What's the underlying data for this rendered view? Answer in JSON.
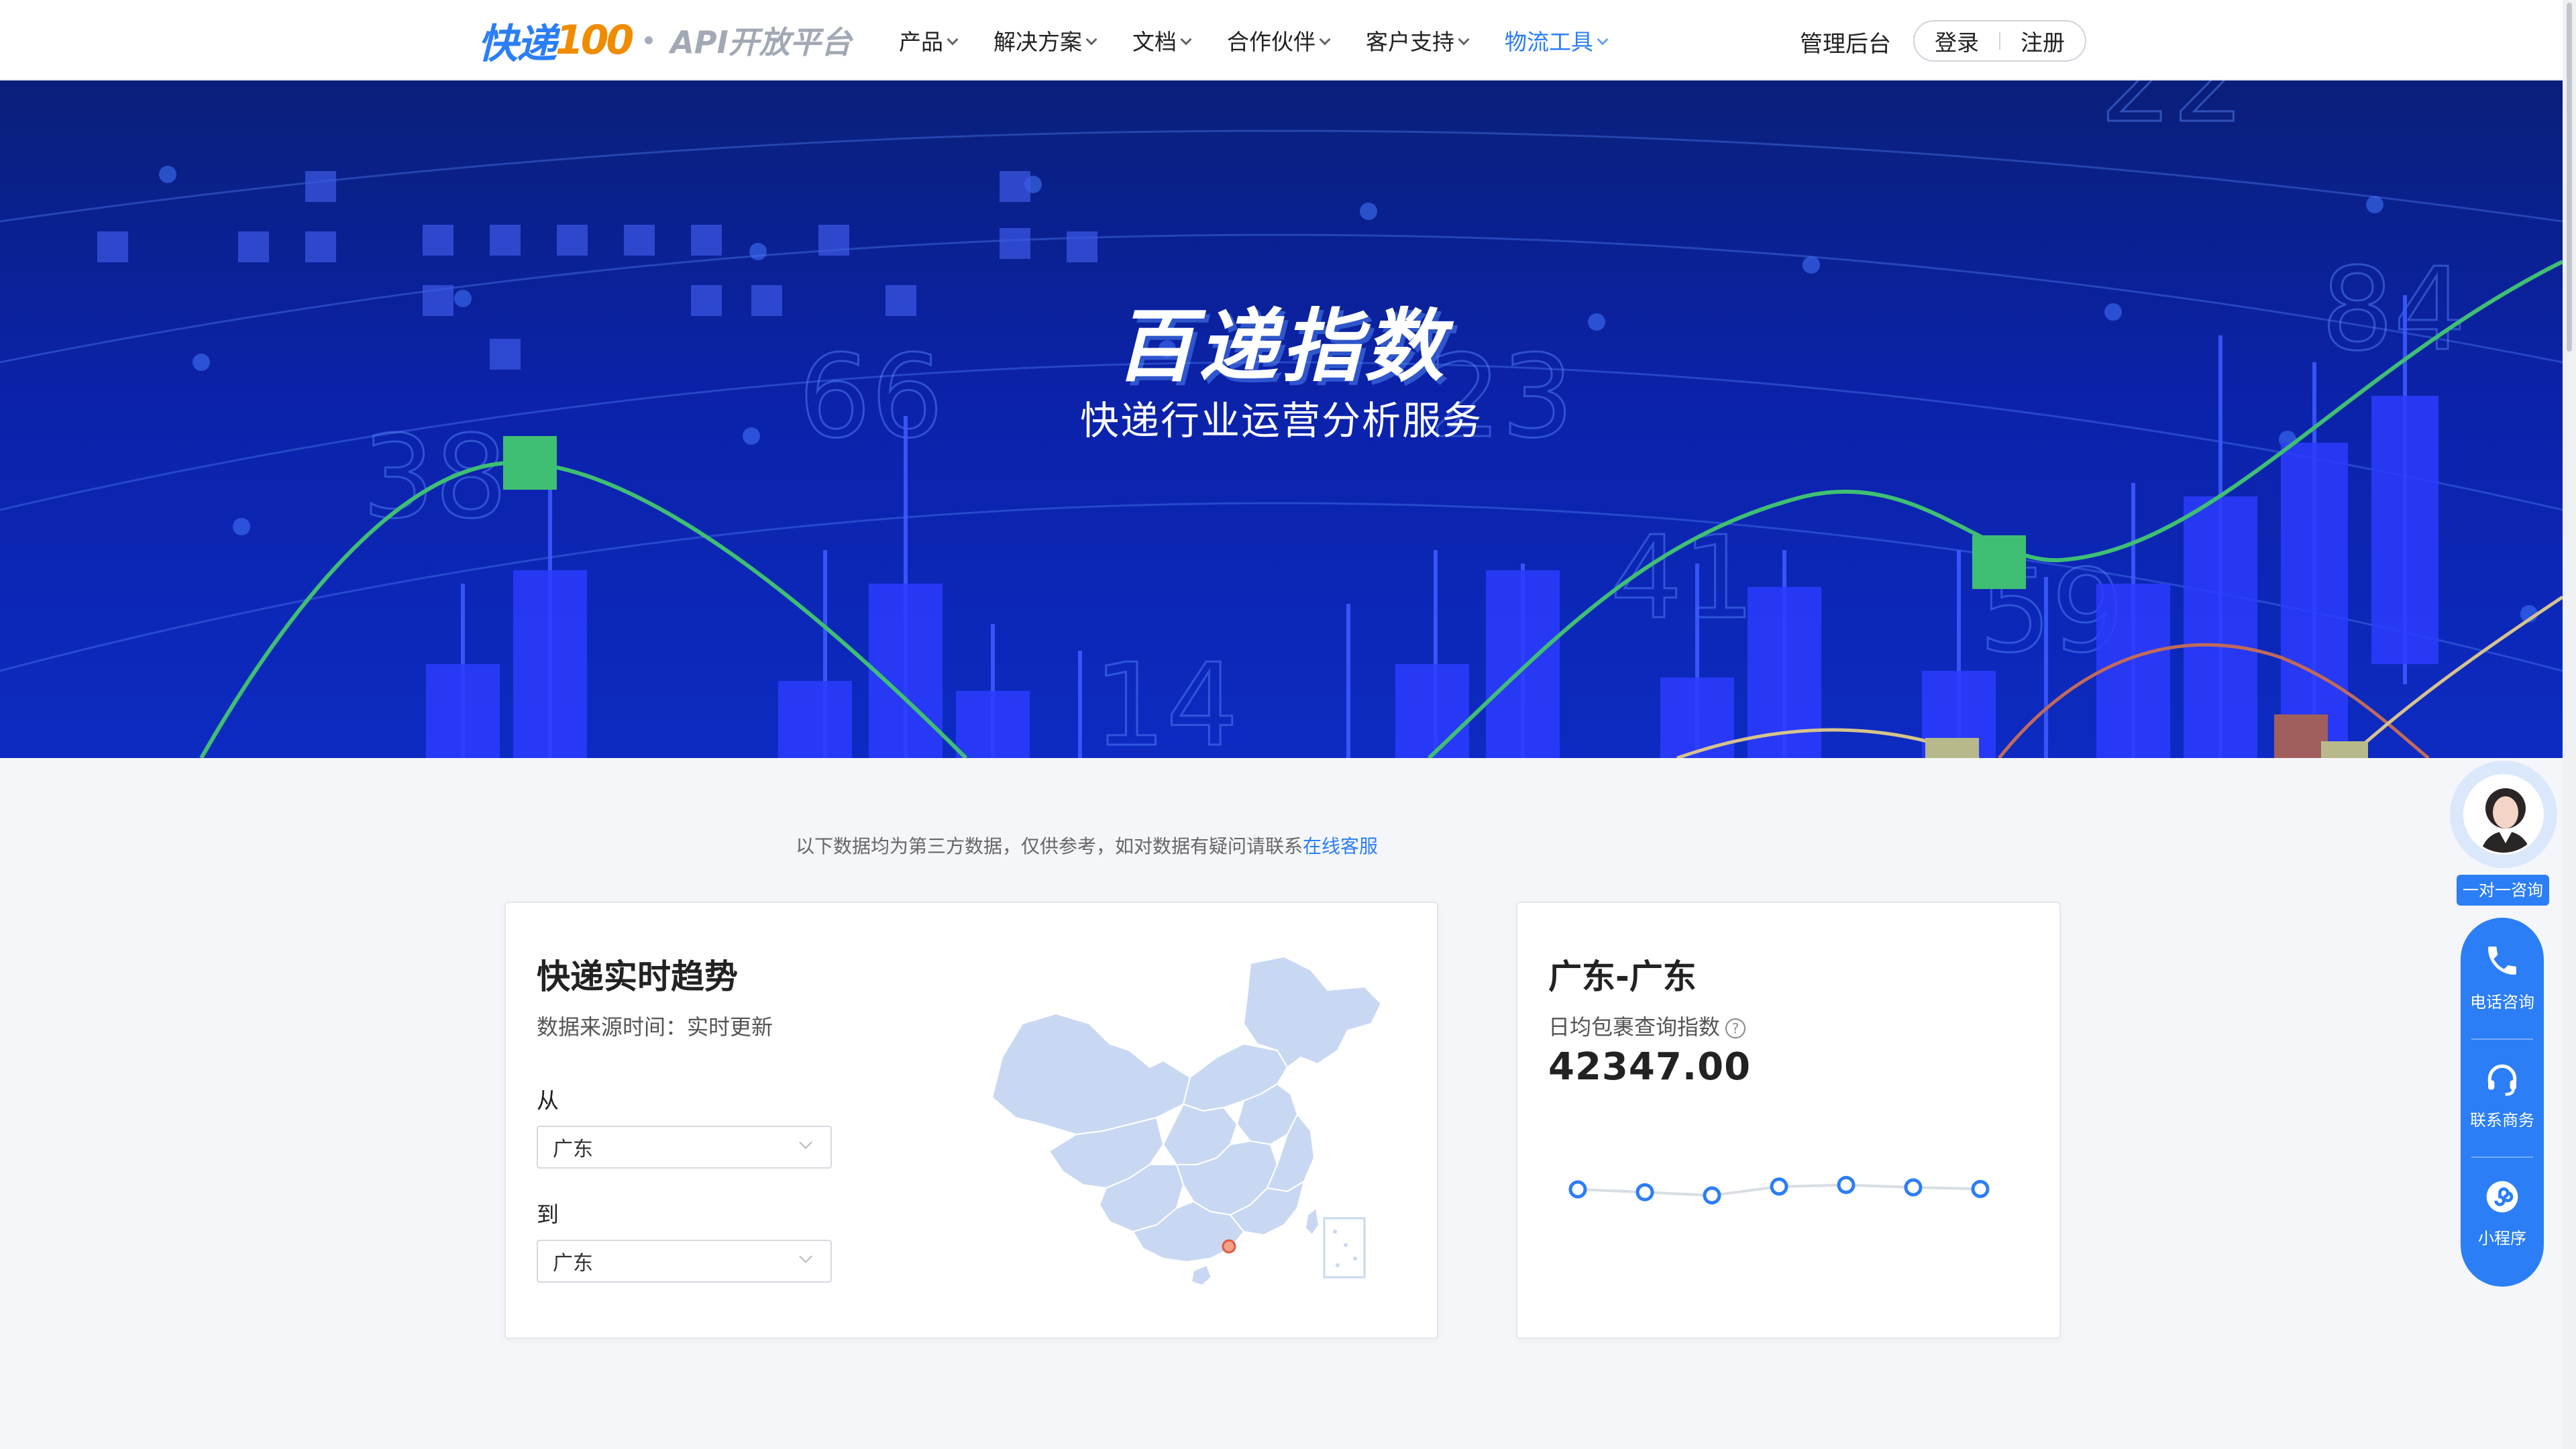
{
  "nav": {
    "logo_main": "快递",
    "logo_num": "100",
    "logo_sub": "API开放平台",
    "items": [
      {
        "label": "产品"
      },
      {
        "label": "解决方案"
      },
      {
        "label": "文档"
      },
      {
        "label": "合作伙伴"
      },
      {
        "label": "客户支持"
      },
      {
        "label": "物流工具"
      }
    ],
    "active_item": "物流工具",
    "admin": "管理后台",
    "login": "登录",
    "register": "注册"
  },
  "hero": {
    "title": "百递指数",
    "subtitle": "快递行业运营分析服务",
    "bg_numbers": [
      "38",
      "66",
      "23",
      "14",
      "41",
      "59",
      "84",
      "22"
    ]
  },
  "notice": {
    "text": "以下数据均为第三方数据，仅供参考，如对数据有疑问请联系",
    "link": "在线客服"
  },
  "trend_card": {
    "title": "快递实时趋势",
    "source": "数据来源时间：实时更新",
    "from_label": "从",
    "from_value": "广东",
    "to_label": "到",
    "to_value": "广东"
  },
  "index_card": {
    "title": "广东-广东",
    "metric_label": "日均包裹查询指数",
    "help": "?",
    "value": "42347.00",
    "spark_values": [
      0.55,
      0.48,
      0.4,
      0.62,
      0.66,
      0.6,
      0.56
    ]
  },
  "side": {
    "consult": "一对一咨询",
    "phone": "电话咨询",
    "business": "联系商务",
    "miniapp": "小程序"
  },
  "colors": {
    "brand": "#2b7ef5",
    "logo_orange": "#f08c00",
    "hero_dark": "#0a1f7a",
    "map_fill": "#c9d8f2"
  }
}
